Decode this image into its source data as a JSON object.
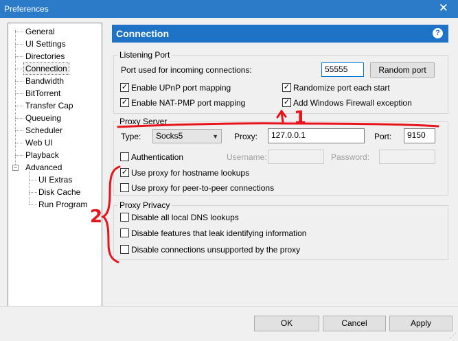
{
  "window": {
    "title": "Preferences",
    "close_glyph": "✕"
  },
  "tree": {
    "items": [
      {
        "label": "General"
      },
      {
        "label": "UI Settings"
      },
      {
        "label": "Directories"
      },
      {
        "label": "Connection",
        "selected": true
      },
      {
        "label": "Bandwidth"
      },
      {
        "label": "BitTorrent"
      },
      {
        "label": "Transfer Cap"
      },
      {
        "label": "Queueing"
      },
      {
        "label": "Scheduler"
      },
      {
        "label": "Web UI"
      },
      {
        "label": "Playback"
      },
      {
        "label": "Advanced",
        "expanded": true
      },
      {
        "label": "UI Extras"
      },
      {
        "label": "Disk Cache"
      },
      {
        "label": "Run Program"
      }
    ],
    "expander_glyph": "−"
  },
  "header": {
    "title": "Connection",
    "help_glyph": "?"
  },
  "listening_port": {
    "title": "Listening Port",
    "port_label": "Port used for incoming connections:",
    "port_value": "55555",
    "random_port_button": "Random port",
    "checks": [
      {
        "label": "Enable UPnP port mapping",
        "checked": true
      },
      {
        "label": "Randomize port each start",
        "checked": true
      },
      {
        "label": "Enable NAT-PMP port mapping",
        "checked": true
      },
      {
        "label": "Add Windows Firewall exception",
        "checked": true
      }
    ]
  },
  "proxy_server": {
    "title": "Proxy Server",
    "type_label": "Type:",
    "type_value": "Socks5",
    "proxy_label": "Proxy:",
    "proxy_value": "127.0.0.1",
    "port_label": "Port:",
    "port_value": "9150",
    "auth_label": "Authentication",
    "auth_checked": false,
    "username_label": "Username:",
    "password_label": "Password:",
    "hostname_label": "Use proxy for hostname lookups",
    "hostname_checked": true,
    "p2p_label": "Use proxy for peer-to-peer connections",
    "p2p_checked": false
  },
  "proxy_privacy": {
    "title": "Proxy Privacy",
    "checks": [
      {
        "label": "Disable all local DNS lookups",
        "checked": false
      },
      {
        "label": "Disable features that leak identifying information",
        "checked": false
      },
      {
        "label": "Disable connections unsupported by the proxy",
        "checked": false
      }
    ]
  },
  "footer": {
    "ok": "OK",
    "cancel": "Cancel",
    "apply": "Apply"
  },
  "annotations": {
    "mark_1": "1",
    "mark_2": "2",
    "color": "#e8141b"
  },
  "colors": {
    "title_bar": "#2b7bc8",
    "header": "#1f73c6",
    "focus": "#0078d7"
  },
  "check_glyph": "✓",
  "dropdown_glyph": "▼",
  "resize_glyph": "⋰"
}
